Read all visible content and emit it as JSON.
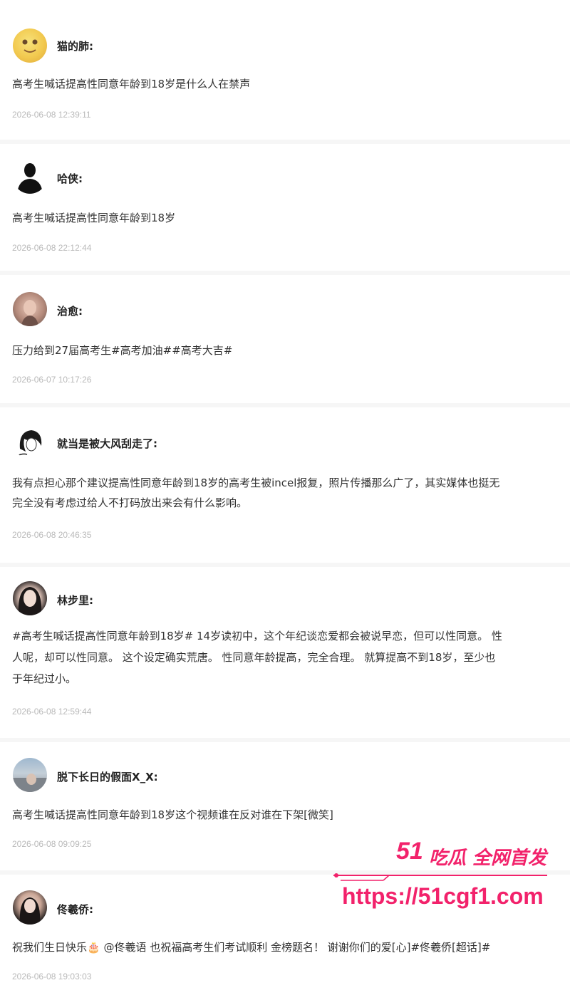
{
  "comments": [
    {
      "username": "猫的肺:",
      "avatar_icon": "cat-avatar-icon",
      "lines": [
        "高考生喊话提高性同意年龄到18岁是什么人在禁声"
      ],
      "time": "2026-06-08 12:39:11"
    },
    {
      "username": "哈侠:",
      "avatar_icon": "silhouette-avatar-icon",
      "lines": [
        "高考生喊话提高性同意年龄到18岁"
      ],
      "time": "2026-06-08 22:12:44"
    },
    {
      "username": "治愈:",
      "avatar_icon": "photo-avatar-icon",
      "lines": [
        "压力给到27届高考生#高考加油##高考大吉#"
      ],
      "time": "2026-06-07 10:17:26"
    },
    {
      "username": "就当是被大风刮走了:",
      "avatar_icon": "sketch-avatar-icon",
      "lines": [
        "我有点担心那个建议提高性同意年龄到18岁的高考生被incel报复，照片传播那么广了，其实媒体也挺无",
        "完全没有考虑过给人不打码放出来会有什么影响。"
      ],
      "time": "2026-06-08 20:46:35"
    },
    {
      "username": "林步里:",
      "avatar_icon": "photo-avatar-icon",
      "lines": [
        "#高考生喊话提高性同意年龄到18岁# 14岁读初中，这个年纪谈恋爱都会被说早恋，但可以性同意。 性",
        "人呢，却可以性同意。 这个设定确实荒唐。 性同意年龄提高，完全合理。 就算提高不到18岁，至少也",
        "于年纪过小。"
      ],
      "time": "2026-06-08 12:59:44"
    },
    {
      "username": "脱下长日的假面X_X:",
      "avatar_icon": "photo-avatar-icon",
      "lines": [
        "高考生喊话提高性同意年龄到18岁这个视频谁在反对谁在下架[微笑]"
      ],
      "time": "2026-06-08 09:09:25"
    },
    {
      "username": "佟羲侨:",
      "avatar_icon": "photo-avatar-icon",
      "lines": [
        "祝我们生日快乐🎂 @佟羲语 也祝福高考生们考试顺利 金榜题名！ 谢谢你们的爱[心]#佟羲侨[超话]#"
      ],
      "time": "2026-06-08 19:03:03"
    }
  ],
  "watermark": {
    "brand": "51",
    "tagline": "吃瓜 全网首发",
    "url": "https://51cgf1.com",
    "color": "#f2226b"
  }
}
